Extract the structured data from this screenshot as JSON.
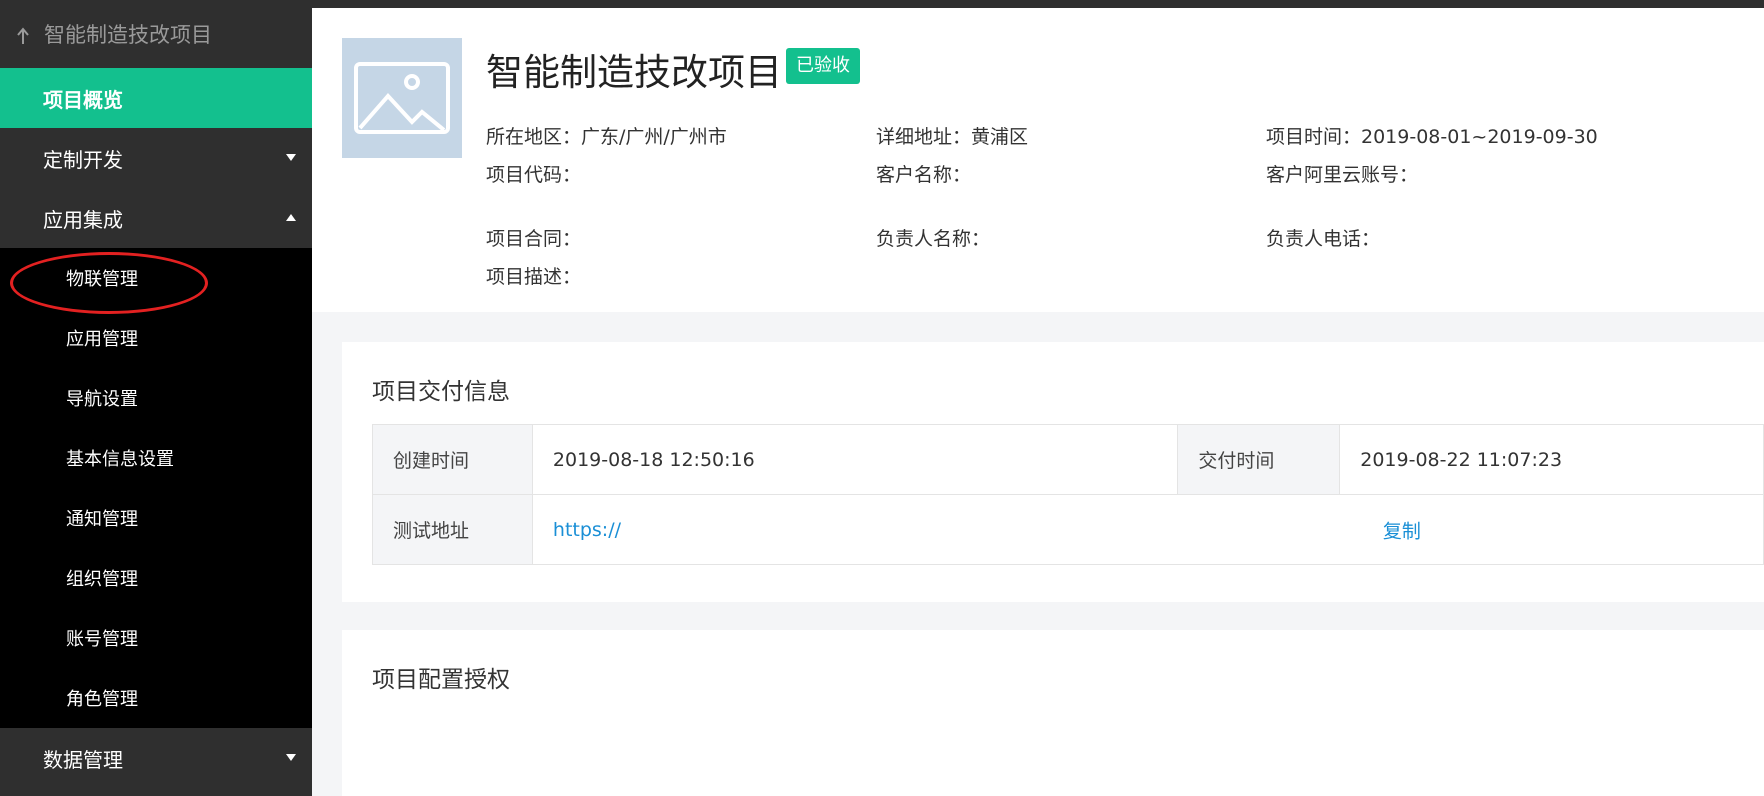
{
  "sidebar": {
    "back_label": "智能制造技改项目",
    "items": [
      {
        "label": "项目概览"
      },
      {
        "label": "定制开发"
      },
      {
        "label": "应用集成"
      }
    ],
    "sub_items": [
      {
        "label": "物联管理"
      },
      {
        "label": "应用管理"
      },
      {
        "label": "导航设置"
      },
      {
        "label": "基本信息设置"
      },
      {
        "label": "通知管理"
      },
      {
        "label": "组织管理"
      },
      {
        "label": "账号管理"
      },
      {
        "label": "角色管理"
      }
    ],
    "bottom_item": {
      "label": "数据管理"
    }
  },
  "project": {
    "title": "智能制造技改项目",
    "status": "已验收",
    "region": "所在地区：广东/广州/广州市",
    "address": "详细地址：黄浦区",
    "time": "项目时间：2019-08-01~2019-09-30",
    "code": "项目代码：",
    "customer": "客户名称：",
    "aliyun": "客户阿里云账号：",
    "contract": "项目合同：",
    "owner": "负责人名称：",
    "phone": "负责人电话：",
    "desc": "项目描述："
  },
  "delivery": {
    "title": "项目交付信息",
    "created_label": "创建时间",
    "created_value": "2019-08-18 12:50:16",
    "delivered_label": "交付时间",
    "delivered_value": "2019-08-22 11:07:23",
    "test_label": "测试地址",
    "test_value": "https://",
    "copy_label": "复制"
  },
  "config": {
    "title": "项目配置授权"
  },
  "colors": {
    "accent": "#13c08e",
    "link": "#1a8fd6",
    "highlight": "#e32121"
  }
}
